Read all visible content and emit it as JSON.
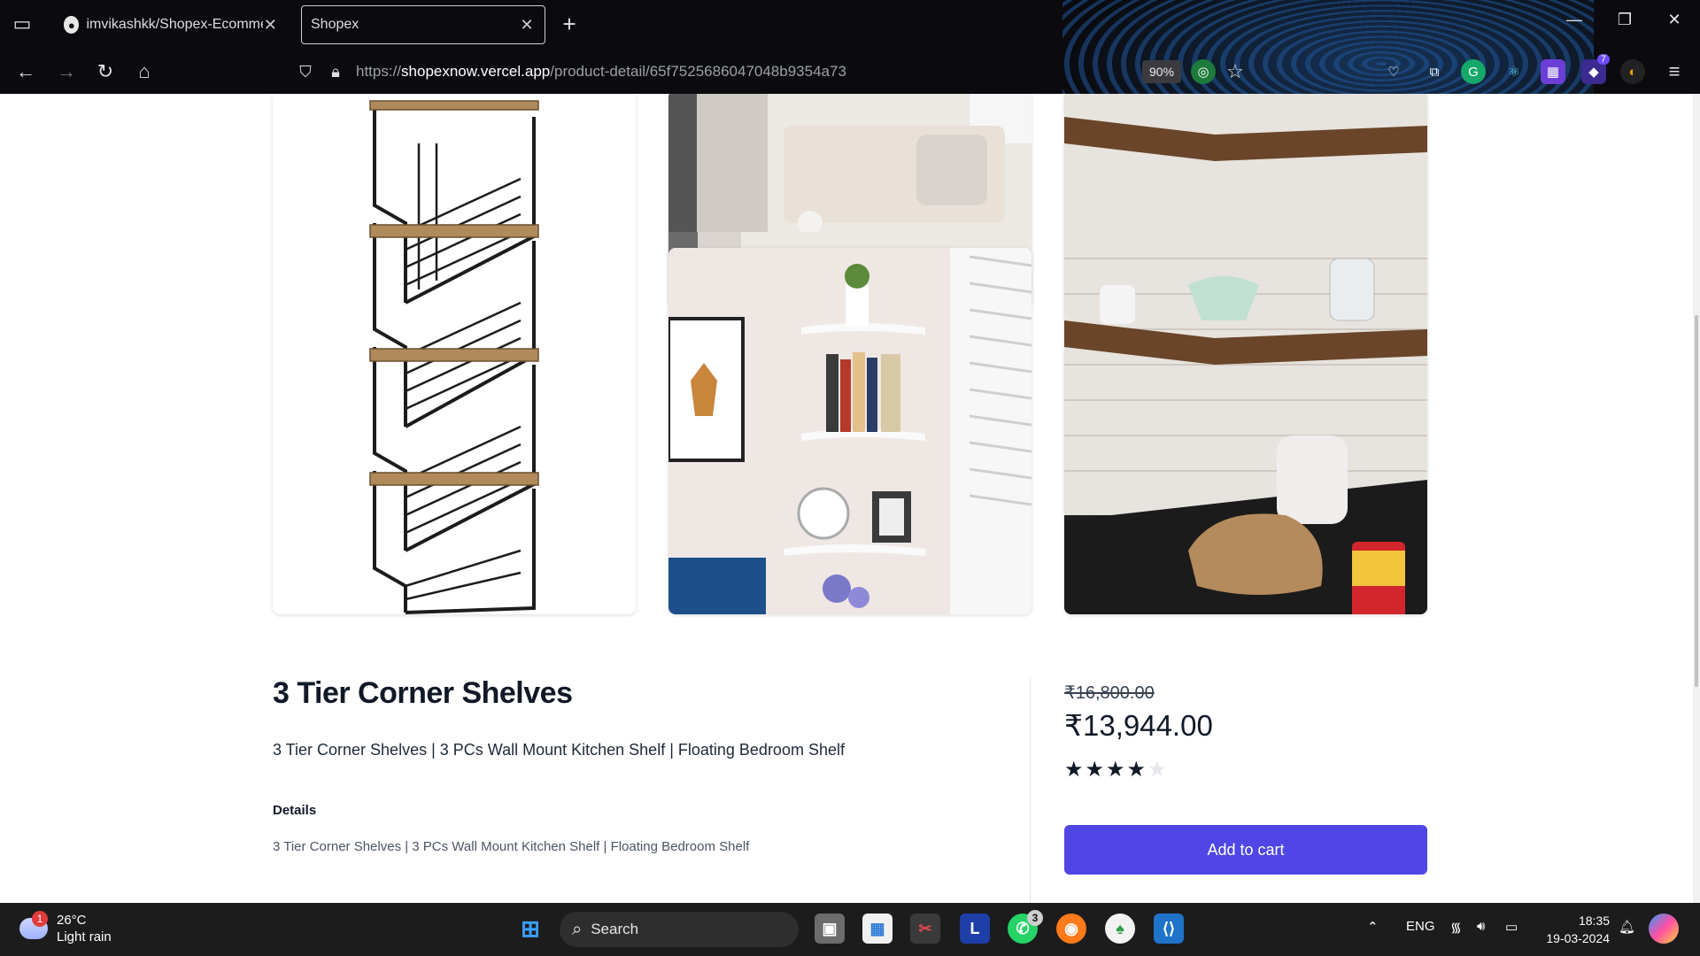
{
  "browser": {
    "tabs": [
      {
        "title": "imvikashkk/Shopex-Ecommerce",
        "favicon": "github-icon",
        "active": false
      },
      {
        "title": "Shopex",
        "active": true
      }
    ],
    "url_prefix": "https://",
    "url_host": "shopexnow.vercel.app",
    "url_path": "/product-detail/65f7525686047048b9354a73",
    "zoom": "90%",
    "extension_badge": "7"
  },
  "product": {
    "title": "3 Tier Corner Shelves",
    "subtitle": "3 Tier Corner Shelves | 3 PCs Wall Mount Kitchen Shelf | Floating Bedroom Shelf",
    "details_heading": "Details",
    "details_text": "3 Tier Corner Shelves | 3 PCs Wall Mount Kitchen Shelf | Floating Bedroom Shelf",
    "old_price": "₹16,800.00",
    "price": "₹13,944.00",
    "rating": 4,
    "rating_max": 5,
    "add_to_cart_label": "Add to cart",
    "colors": {
      "accent": "#4f46e5",
      "star_filled": "#111827",
      "star_empty": "#e5e7eb"
    }
  },
  "taskbar": {
    "weather_temp": "26°C",
    "weather_desc": "Light rain",
    "weather_badge": "1",
    "search_label": "Search",
    "whatsapp_badge": "3",
    "language": "ENG",
    "time": "18:35",
    "date": "19-03-2024"
  }
}
